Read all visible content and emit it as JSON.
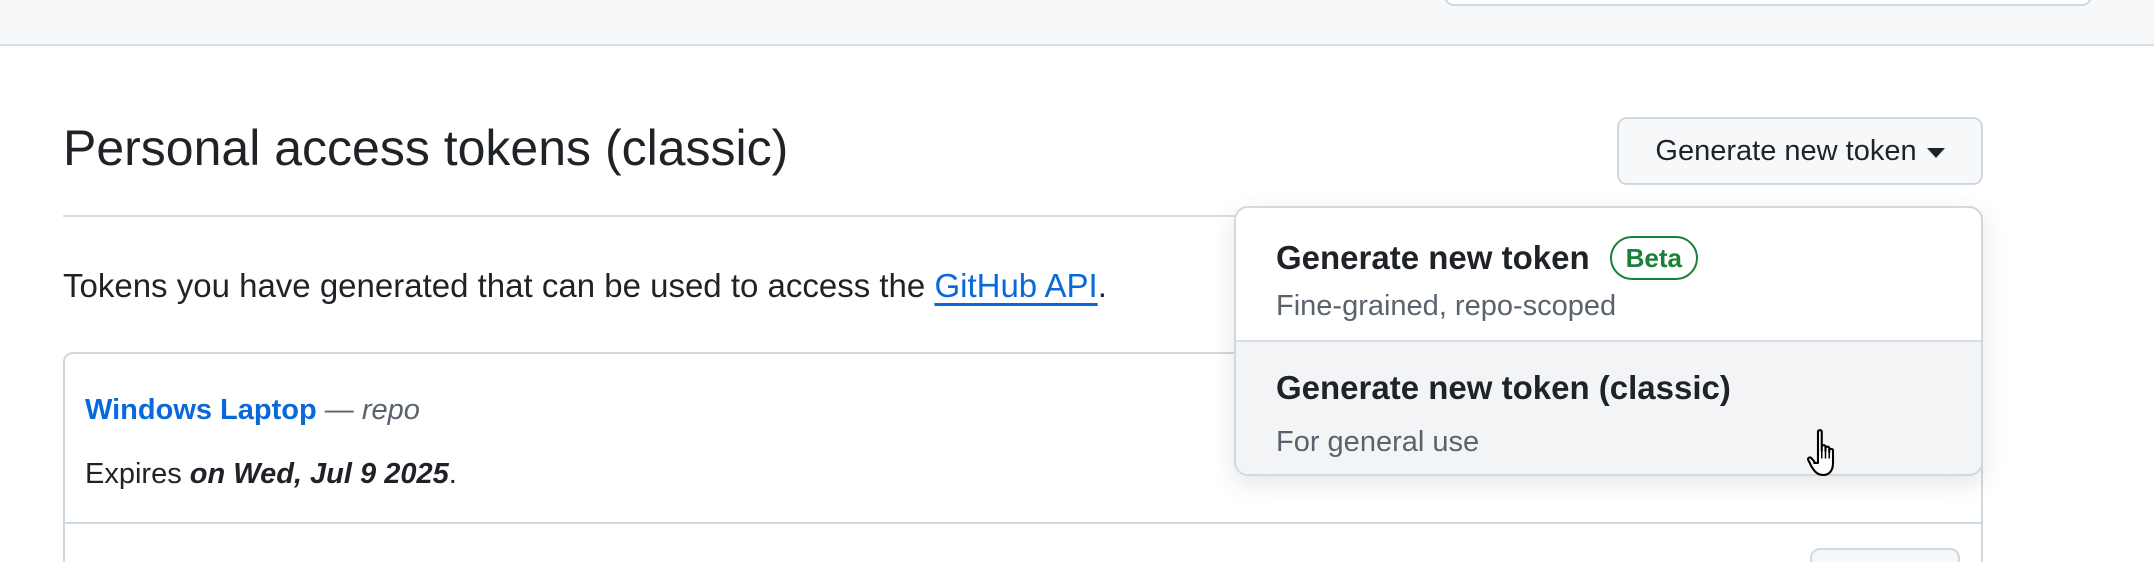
{
  "page": {
    "title": "Personal access tokens (classic)",
    "generate_button_label": "Generate new token",
    "description_prefix": "Tokens you have generated that can be used to access the ",
    "description_link": "GitHub API",
    "description_suffix": "."
  },
  "tokens": [
    {
      "name": "Windows Laptop",
      "scope": " — repo",
      "expires_prefix": "Expires ",
      "expires_date": "on Wed, Jul 9 2025",
      "expires_suffix": "."
    }
  ],
  "dropdown": {
    "items": [
      {
        "title": "Generate new token",
        "badge": "Beta",
        "subtitle": "Fine-grained, repo-scoped",
        "highlighted": false
      },
      {
        "title": "Generate new token (classic)",
        "subtitle": "For general use",
        "highlighted": true
      }
    ]
  },
  "colors": {
    "link": "#0969da",
    "beta_badge": "#1a7f37",
    "muted_text": "#59636e",
    "border": "#d1d9e0"
  },
  "icons": {
    "caret": "triangle-down-icon",
    "cursor": "hand-pointer-cursor-icon"
  }
}
